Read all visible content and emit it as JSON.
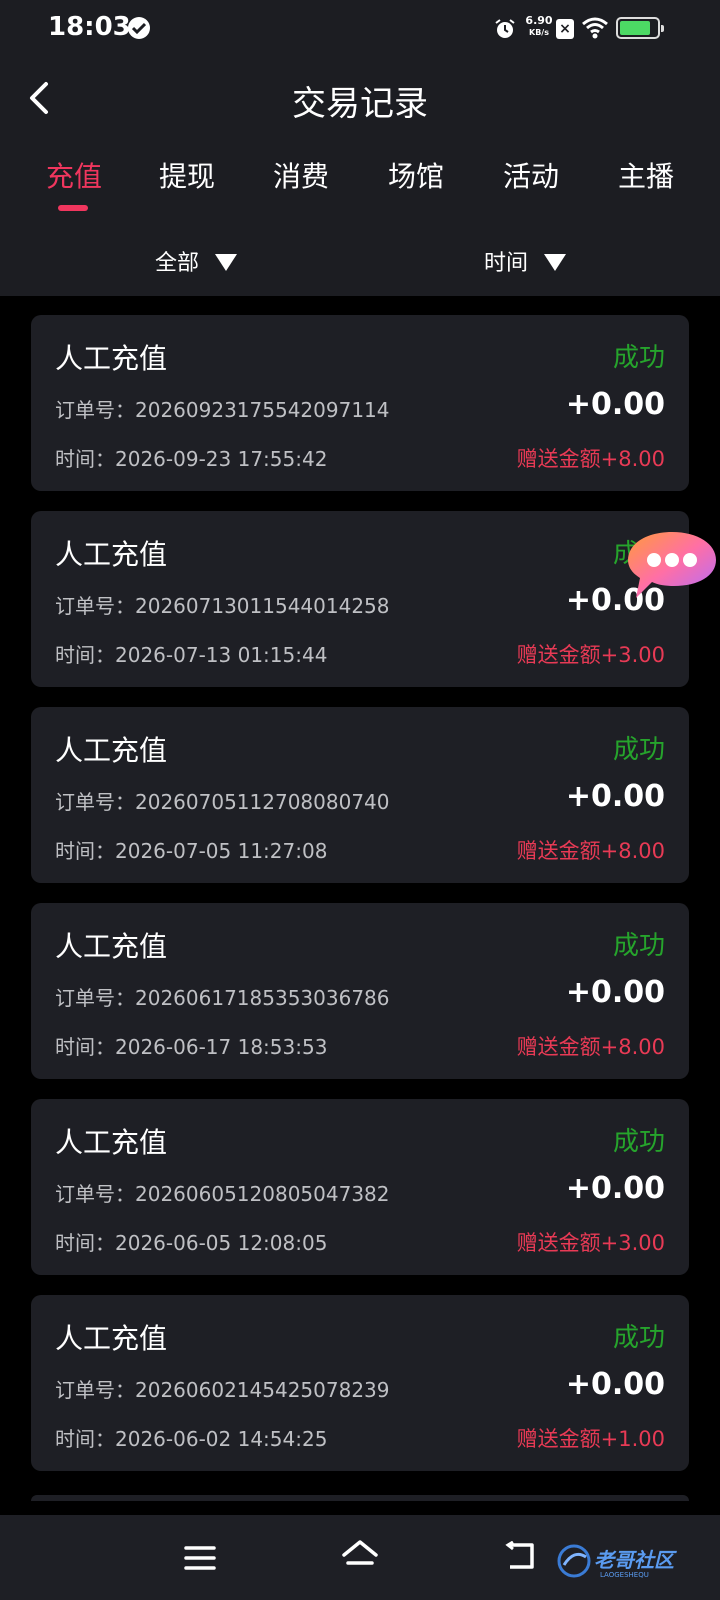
{
  "status_bar": {
    "time": "18:03",
    "net_speed": "6.90",
    "net_unit": "KB/s"
  },
  "header": {
    "title": "交易记录"
  },
  "tabs": [
    "充值",
    "提现",
    "消费",
    "场馆",
    "活动",
    "主播"
  ],
  "filters": {
    "category": "全部",
    "time": "时间"
  },
  "records": [
    {
      "title": "人工充值",
      "status": "成功",
      "order_label": "订单号：",
      "order": "20260923175542097114",
      "amount": "+0.00",
      "time_label": "时间：",
      "time": "2026-09-23 17:55:42",
      "bonus": "赠送金额+8.00"
    },
    {
      "title": "人工充值",
      "status": "成功",
      "order_label": "订单号：",
      "order": "20260713011544014258",
      "amount": "+0.00",
      "time_label": "时间：",
      "time": "2026-07-13 01:15:44",
      "bonus": "赠送金额+3.00"
    },
    {
      "title": "人工充值",
      "status": "成功",
      "order_label": "订单号：",
      "order": "20260705112708080740",
      "amount": "+0.00",
      "time_label": "时间：",
      "time": "2026-07-05 11:27:08",
      "bonus": "赠送金额+8.00"
    },
    {
      "title": "人工充值",
      "status": "成功",
      "order_label": "订单号：",
      "order": "20260617185353036786",
      "amount": "+0.00",
      "time_label": "时间：",
      "time": "2026-06-17 18:53:53",
      "bonus": "赠送金额+8.00"
    },
    {
      "title": "人工充值",
      "status": "成功",
      "order_label": "订单号：",
      "order": "20260605120805047382",
      "amount": "+0.00",
      "time_label": "时间：",
      "time": "2026-06-05 12:08:05",
      "bonus": "赠送金额+3.00"
    },
    {
      "title": "人工充值",
      "status": "成功",
      "order_label": "订单号：",
      "order": "20260602145425078239",
      "amount": "+0.00",
      "time_label": "时间：",
      "time": "2026-06-02 14:54:25",
      "bonus": "赠送金额+1.00"
    }
  ],
  "watermark": {
    "text": "老哥社区",
    "sub": "LAOGESHEQU"
  },
  "colors": {
    "accent": "#f0365e",
    "success": "#26a42c",
    "bonus": "#e83a55",
    "card_bg": "#1e1f25",
    "header_bg": "#1c1d22"
  }
}
